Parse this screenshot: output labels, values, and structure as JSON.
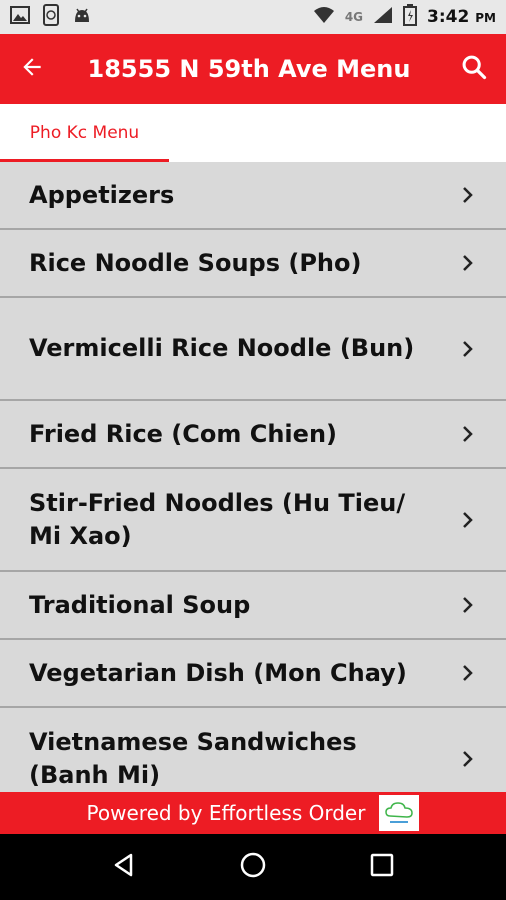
{
  "status_bar": {
    "network": "4G",
    "time": "3:42",
    "ampm": "PM",
    "icons": [
      "image-icon",
      "phone-sync-icon",
      "android-icon",
      "wifi-icon",
      "signal-icon",
      "battery-icon"
    ]
  },
  "app_bar": {
    "title": "18555 N 59th Ave Menu",
    "back_icon": "arrow-left-icon",
    "search_icon": "search-icon"
  },
  "tabs": [
    {
      "label": "Pho Kc Menu",
      "active": true
    }
  ],
  "menu_items": [
    {
      "label": "Appetizers"
    },
    {
      "label": "Rice Noodle Soups (Pho)"
    },
    {
      "label": "Vermicelli Rice Noodle (Bun)"
    },
    {
      "label": "Fried Rice (Com Chien)"
    },
    {
      "label": "Stir-Fried Noodles (Hu Tieu/ Mi Xao)"
    },
    {
      "label": "Traditional Soup"
    },
    {
      "label": "Vegetarian Dish (Mon Chay)"
    },
    {
      "label": "Vietnamese Sandwiches (Banh Mi)"
    }
  ],
  "footer": {
    "text": "Powered by Effortless Order",
    "logo": "effortless-order-logo"
  },
  "nav_bar": {
    "icons": [
      "back-triangle-icon",
      "home-circle-icon",
      "recents-square-icon"
    ]
  },
  "colors": {
    "primary": "#ed1c24",
    "list_bg": "#d9d9d9",
    "divider": "#a6a6a6"
  }
}
